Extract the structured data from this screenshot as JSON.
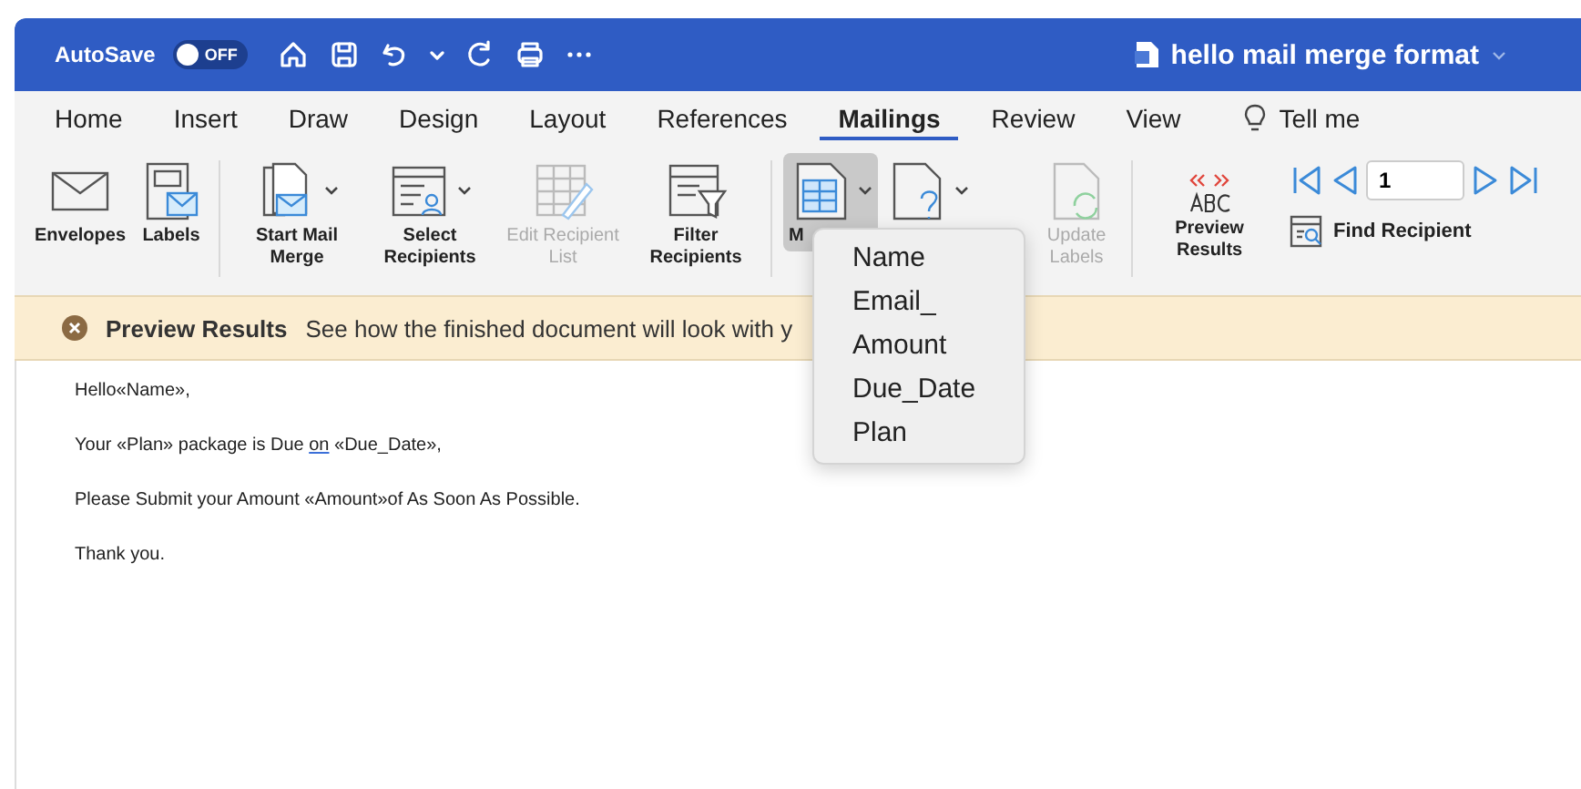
{
  "window": {
    "autosave_label": "AutoSave",
    "autosave_toggle": {
      "label": "OFF",
      "on": false
    },
    "title": "hello mail merge format"
  },
  "tabs": [
    {
      "label": "Home",
      "selected": false
    },
    {
      "label": "Insert",
      "selected": false
    },
    {
      "label": "Draw",
      "selected": false
    },
    {
      "label": "Design",
      "selected": false
    },
    {
      "label": "Layout",
      "selected": false
    },
    {
      "label": "References",
      "selected": false
    },
    {
      "label": "Mailings",
      "selected": true
    },
    {
      "label": "Review",
      "selected": false
    },
    {
      "label": "View",
      "selected": false
    }
  ],
  "tell_me": "Tell me",
  "ribbon": {
    "groups": [
      [
        {
          "label": "Envelopes",
          "kind": "envelope",
          "disabled": false,
          "dropdown": false,
          "selected": false
        },
        {
          "label": "Labels",
          "kind": "labels",
          "disabled": false,
          "dropdown": false,
          "selected": false
        }
      ],
      [
        {
          "label": "Start Mail Merge",
          "kind": "start",
          "disabled": false,
          "dropdown": true,
          "selected": false
        },
        {
          "label": "Select Recipients",
          "kind": "select",
          "disabled": false,
          "dropdown": true,
          "selected": false
        },
        {
          "label": "Edit Recipient List",
          "kind": "edit",
          "disabled": true,
          "dropdown": false,
          "selected": false
        },
        {
          "label": "Filter Recipients",
          "kind": "filter",
          "disabled": false,
          "dropdown": false,
          "selected": false
        }
      ],
      [
        {
          "label": "M",
          "kind": "field",
          "disabled": false,
          "dropdown": true,
          "selected": true
        },
        {
          "kind": "rules",
          "disabled": false,
          "dropdown": true,
          "selected": false
        },
        {
          "label": "Update Labels",
          "kind": "update",
          "disabled": true,
          "dropdown": false,
          "selected": false
        }
      ]
    ],
    "preview": {
      "label": "Preview Results",
      "record": "1",
      "find": "Find Recipient"
    }
  },
  "message_bar": {
    "title": "Preview Results",
    "text": "See how the finished document will look with y"
  },
  "document": {
    "paragraphs": [
      [
        {
          "text": "Hello«Name»,",
          "flagged": false
        }
      ],
      [
        {
          "text": "Your «Plan» package is Due ",
          "flagged": false
        },
        {
          "text": "on",
          "flagged": true
        },
        {
          "text": " «Due_Date»,",
          "flagged": false
        }
      ],
      [
        {
          "text": "Please Submit your Amount «Amount»of As Soon As Possible.",
          "flagged": false
        }
      ],
      [
        {
          "text": "Thank you.",
          "flagged": false
        }
      ]
    ]
  },
  "merge_field_menu": {
    "items": [
      {
        "label": "Name"
      },
      {
        "label": "Email_"
      },
      {
        "label": "Amount"
      },
      {
        "label": "Due_Date"
      },
      {
        "label": "Plan"
      }
    ]
  }
}
